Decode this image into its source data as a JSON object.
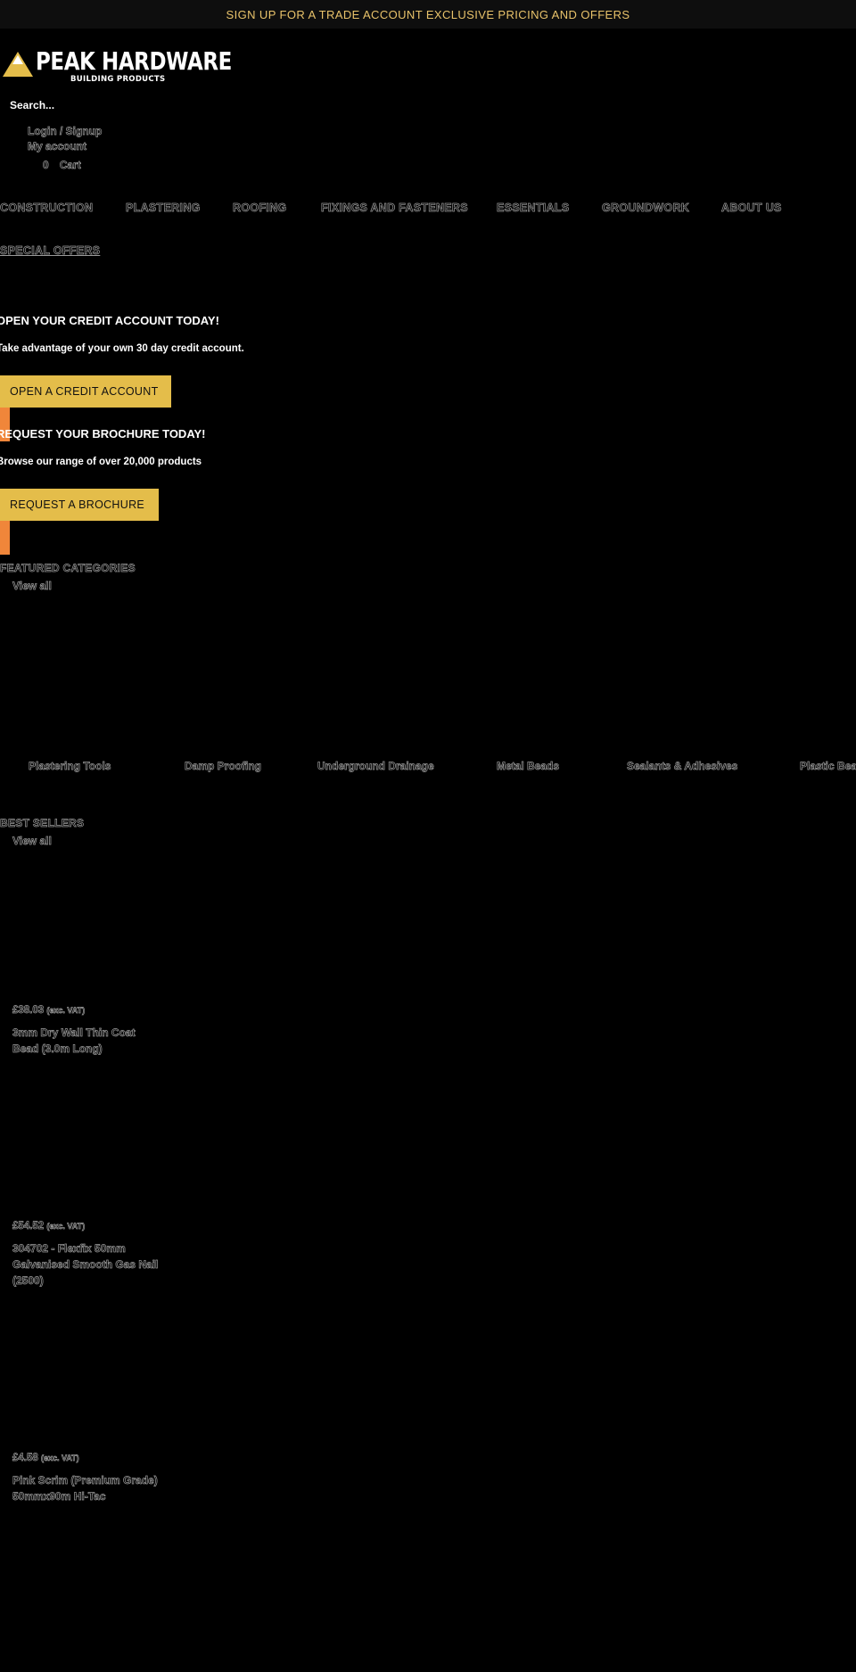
{
  "announcement": "SIGN UP FOR A TRADE ACCOUNT EXCLUSIVE PRICING AND OFFERS",
  "logo": {
    "name": "PEAK HARDWARE",
    "tagline": "BUILDING PRODUCTS"
  },
  "search": {
    "placeholder": "Search..."
  },
  "account": {
    "login_label": "Login / Signup",
    "my_account_label": "My account",
    "cart_count": "0",
    "cart_label": "Cart"
  },
  "nav": {
    "items": [
      "CONSTRUCTION",
      "PLASTERING",
      "ROOFING",
      "FIXINGS AND FASTENERS",
      "ESSENTIALS",
      "GROUNDWORK",
      "ABOUT US"
    ],
    "special": "SPECIAL OFFERS"
  },
  "promos": [
    {
      "title": "OPEN YOUR CREDIT ACCOUNT TODAY!",
      "text": "Take advantage of your own 30 day credit account.",
      "button": "OPEN A CREDIT ACCOUNT"
    },
    {
      "title": "REQUEST YOUR BROCHURE TODAY!",
      "text": "Browse our range of over 20,000 products",
      "button": "REQUEST A BROCHURE"
    }
  ],
  "featured": {
    "heading": "FEATURED CATEGORIES",
    "view_all": "View all",
    "categories": [
      "Plastering Tools",
      "Damp Proofing",
      "Underground Drainage",
      "Metal Beads",
      "Sealants & Adhesives",
      "Plastic Beads"
    ]
  },
  "best_sellers": {
    "heading": "BEST SELLERS",
    "view_all": "View all",
    "products": [
      {
        "price": "£38.03",
        "vat": "(exc. VAT)",
        "name": "3mm Dry Wall Thin Coat Bead (3.0m Long)"
      },
      {
        "price": "£54.52",
        "vat": "(exc. VAT)",
        "name": "304702 - Flexfix 50mm Galvanised Smooth Gas Nail (2500)"
      },
      {
        "price": "£4.58",
        "vat": "(exc. VAT)",
        "name": "Pink Scrim (Premium Grade) 50mmx90m Hi-Tac"
      }
    ]
  },
  "colors": {
    "background": "#000000",
    "announcement_text": "#e8c26a",
    "button": "#e4bd4a",
    "accent": "#f0863a"
  }
}
